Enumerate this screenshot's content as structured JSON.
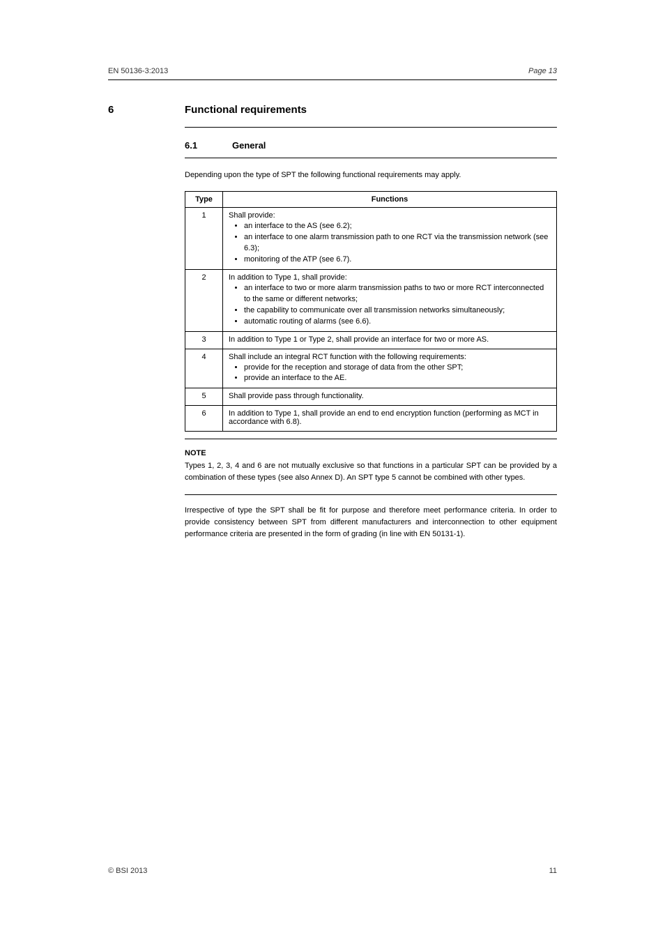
{
  "header": {
    "doc_ref": "EN 50136-3:2013",
    "page_hint": "Page 13"
  },
  "section": {
    "num": "6",
    "title": "Functional requirements"
  },
  "subsection": {
    "num": "6.1",
    "title": "General"
  },
  "intro": "Depending upon the type of SPT the following functional requirements may apply.",
  "table": {
    "headers": {
      "type": "Type",
      "functions": "Functions"
    },
    "rows": [
      {
        "type": "1",
        "label": "Shall provide:",
        "items": [
          "an interface to the AS (see 6.2);",
          "an interface to one alarm transmission path to one RCT via the transmission network (see 6.3);",
          "monitoring of the ATP (see 6.7)."
        ]
      },
      {
        "type": "2",
        "label": "In addition to Type 1, shall provide:",
        "items": [
          "an interface to two or more alarm transmission paths to two or more RCT interconnected to the same or different networks;",
          "the capability to communicate over all transmission networks simultaneously;",
          "automatic routing of alarms (see 6.6)."
        ]
      },
      {
        "type": "3",
        "label": "In addition to Type 1 or Type 2, shall provide an interface for two or more AS.",
        "items": []
      },
      {
        "type": "4",
        "label": "Shall include an integral RCT function with the following requirements:",
        "items": [
          "provide for the reception and storage of data from the other SPT;",
          "provide an interface to the AE."
        ]
      },
      {
        "type": "5",
        "label": "Shall provide pass through functionality.",
        "items": []
      },
      {
        "type": "6",
        "label": "In addition to Type 1, shall provide an end to end encryption function (performing as MCT in accordance with 6.8).",
        "items": []
      }
    ]
  },
  "note": {
    "label": "NOTE",
    "text": "Types 1, 2, 3, 4 and 6 are not mutually exclusive so that functions in a particular SPT can be provided by a combination of these types (see also Annex D). An SPT type 5 cannot be combined with other types."
  },
  "paragraph_after": "Irrespective of type the SPT shall be fit for purpose and therefore meet performance criteria. In order to provide consistency between SPT from different manufacturers and interconnection to other equipment performance criteria are presented in the form of grading (in line with EN 50131-1).",
  "footer": {
    "copyright": "© BSI 2013",
    "page": "11"
  }
}
